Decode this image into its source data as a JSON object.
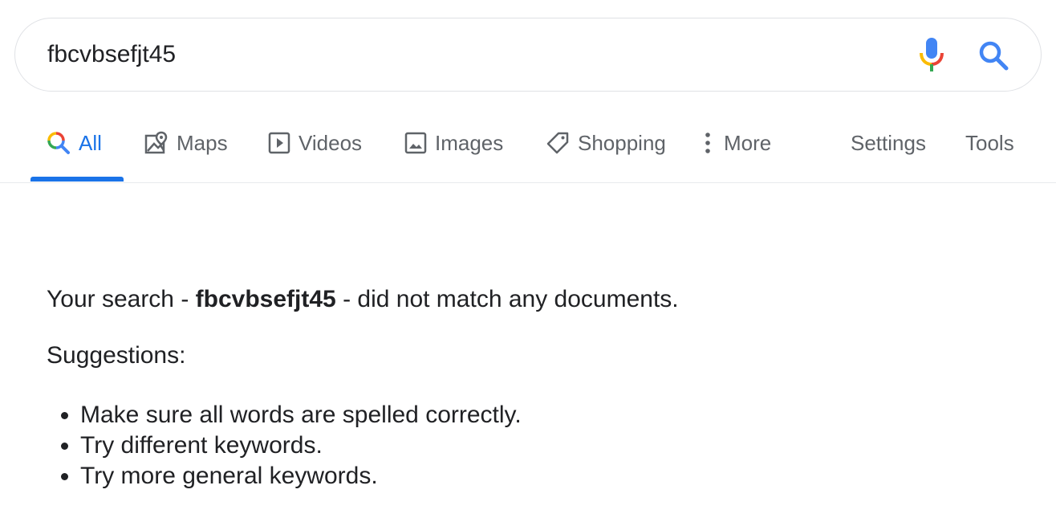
{
  "search": {
    "value": "fbcvbsefjt45",
    "placeholder": ""
  },
  "tabs": [
    {
      "label": "All",
      "icon": "search-multicolor-icon",
      "active": true
    },
    {
      "label": "Maps",
      "icon": "map-pin-icon",
      "active": false
    },
    {
      "label": "Videos",
      "icon": "play-icon",
      "active": false
    },
    {
      "label": "Images",
      "icon": "image-icon",
      "active": false
    },
    {
      "label": "Shopping",
      "icon": "tag-icon",
      "active": false
    },
    {
      "label": "More",
      "icon": "more-vert-icon",
      "active": false
    }
  ],
  "tools": {
    "settings_label": "Settings",
    "tools_label": "Tools"
  },
  "results": {
    "prefix": "Your search - ",
    "query": "fbcvbsefjt45",
    "suffix": " - did not match any documents.",
    "suggestions_title": "Suggestions:",
    "suggestions": [
      "Make sure all words are spelled correctly.",
      "Try different keywords.",
      "Try more general keywords."
    ]
  },
  "colors": {
    "accent": "#1a73e8",
    "tab_text": "#5f6368",
    "body_text": "#202124",
    "border": "#dfe1e5"
  }
}
